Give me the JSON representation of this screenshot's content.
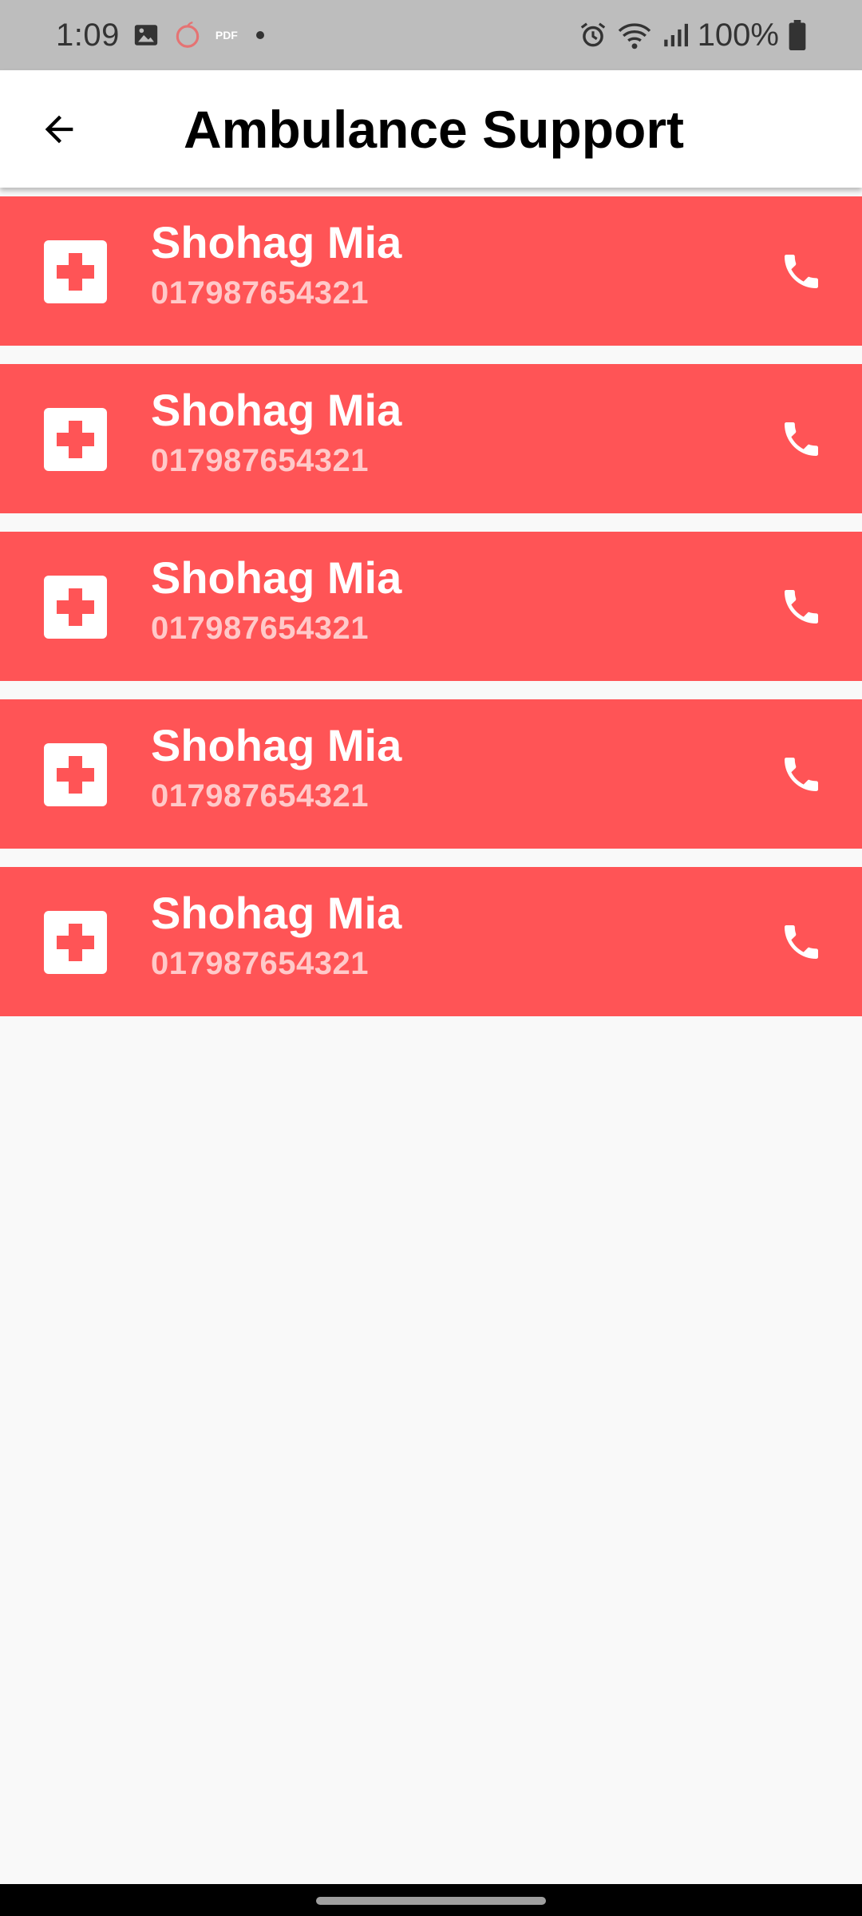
{
  "status_bar": {
    "time": "1:09",
    "pdf_label": "PDF",
    "battery": "100%",
    "icons": [
      "image-icon",
      "app-icon",
      "pdf-icon",
      "dot-icon",
      "alarm-icon",
      "wifi-icon",
      "signal-icon",
      "battery-icon"
    ]
  },
  "app_bar": {
    "back_icon": "arrow-left-icon",
    "title": "Ambulance Support"
  },
  "contacts": [
    {
      "name": "Shohag Mia",
      "phone": "017987654321"
    },
    {
      "name": "Shohag Mia",
      "phone": "017987654321"
    },
    {
      "name": "Shohag Mia",
      "phone": "017987654321"
    },
    {
      "name": "Shohag Mia",
      "phone": "017987654321"
    },
    {
      "name": "Shohag Mia",
      "phone": "017987654321"
    }
  ],
  "colors": {
    "card_background": "#ff5456",
    "card_phone_text": "#ffc9c9",
    "page_background": "#f9f9f9",
    "status_bar_background": "#bdbdbd"
  }
}
